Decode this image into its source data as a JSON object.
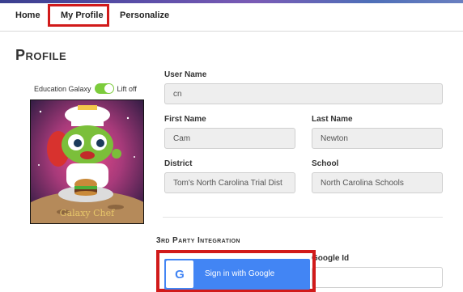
{
  "nav": {
    "items": [
      {
        "label": "Home"
      },
      {
        "label": "My Profile"
      },
      {
        "label": "Personalize"
      }
    ],
    "active": "My Profile"
  },
  "page": {
    "title": "Profile"
  },
  "toggle": {
    "left_label": "Education Galaxy",
    "right_label": "Lift off",
    "state": "on"
  },
  "avatar": {
    "caption": "Galaxy Chef"
  },
  "form": {
    "username": {
      "label": "User Name",
      "value": "cn"
    },
    "first_name": {
      "label": "First Name",
      "value": "Cam"
    },
    "last_name": {
      "label": "Last Name",
      "value": "Newton"
    },
    "district": {
      "label": "District",
      "value": "Tom's North Carolina Trial Dist"
    },
    "school": {
      "label": "School",
      "value": "North Carolina Schools"
    }
  },
  "integration": {
    "title": "3rd Party Integration",
    "google_button_label": "Sign in with Google",
    "google_id_label": "Google Id",
    "google_id_value": ""
  },
  "colors": {
    "highlight": "#d11a1a",
    "google_blue": "#4285f4",
    "toggle_green": "#7ccc3c"
  }
}
